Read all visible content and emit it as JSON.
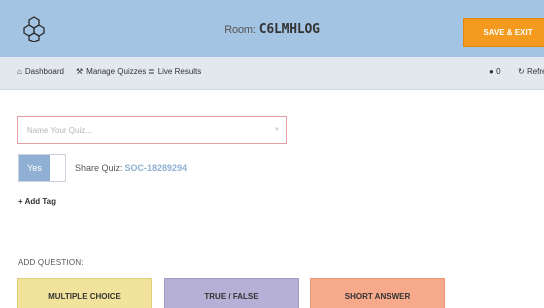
{
  "header": {
    "logo_icon": "honeycomb-logo-icon",
    "room_label": "Room:",
    "room_code": "C6LMHLOG",
    "save_exit_label": "SAVE & EXIT",
    "background_color": "#a4c4e4",
    "save_button_color": "#f49a1e"
  },
  "nav": {
    "items": [
      {
        "icon": "home-icon",
        "label": "Dashboard"
      },
      {
        "icon": "wrench-icon",
        "label": "Manage Quizzes"
      },
      {
        "icon": "bar-chart-icon",
        "label": "Live Results"
      }
    ],
    "user_count": "0",
    "refresh_label": "Refre"
  },
  "quiz": {
    "name_placeholder": "Name Your Quiz...",
    "toggle_label": "Yes",
    "share_label": "Share Quiz:",
    "share_code": "SOC-18289294",
    "add_tag_label": "+ Add Tag"
  },
  "add_question": {
    "label": "ADD QUESTION:",
    "buttons": [
      {
        "label": "MULTIPLE CHOICE",
        "color": "#f2e39c"
      },
      {
        "label": "TRUE / FALSE",
        "color": "#b7b0d6"
      },
      {
        "label": "SHORT ANSWER",
        "color": "#f7a98c"
      }
    ]
  }
}
